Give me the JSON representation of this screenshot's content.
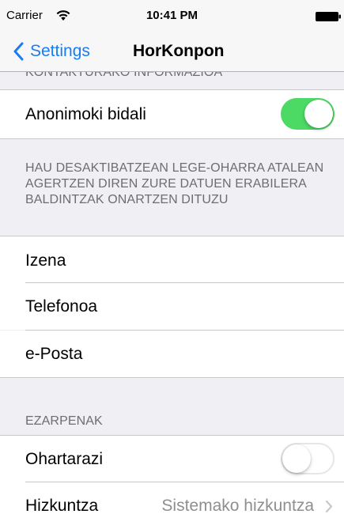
{
  "status_bar": {
    "carrier": "Carrier",
    "time": "10:41 PM",
    "wifi_icon": "wifi-icon",
    "battery_icon": "battery-icon"
  },
  "nav": {
    "back_label": "Settings",
    "title": "HorKonpon"
  },
  "sections": {
    "contact_header": "KONTAKTURAKO INFORMAZIOA",
    "anonymous_label": "Anonimoki bidali",
    "anonymous_on": true,
    "disclaimer": "HAU DESAKTIBATZEAN LEGE-OHARRA ATALEAN AGERTZEN DIREN ZURE DATUEN ERABILERA BALDINTZAK ONARTZEN DITUZU",
    "name_label": "Izena",
    "phone_label": "Telefonoa",
    "email_label": "e-Posta",
    "settings_header": "EZARPENAK",
    "notify_label": "Ohartarazi",
    "notify_on": false,
    "language_label": "Hizkuntza",
    "language_value": "Sistemako hizkuntza"
  },
  "colors": {
    "accent": "#1a7cf2",
    "toggle_on": "#4cd964",
    "background": "#efeff4"
  }
}
